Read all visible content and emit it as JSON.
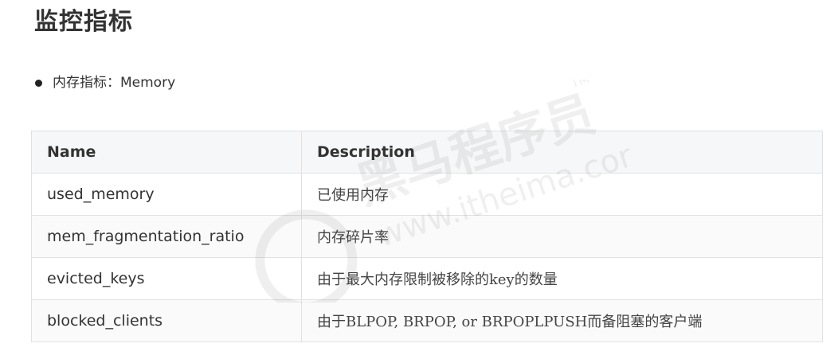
{
  "page": {
    "title": "监控指标"
  },
  "bullet": {
    "text": "内存指标：Memory"
  },
  "table": {
    "headers": [
      "Name",
      "Description"
    ],
    "rows": [
      {
        "name": "used_memory",
        "description": "已使用内存"
      },
      {
        "name": "mem_fragmentation_ratio",
        "description": "内存碎片率"
      },
      {
        "name": "evicted_keys",
        "description": "由于最大内存限制被移除的key的数量"
      },
      {
        "name": "blocked_clients",
        "description": "由于BLPOP, BRPOP, or BRPOPLPUSH而备阻塞的客户端"
      }
    ]
  },
  "watermark": {
    "brand": "黑马程序员",
    "url": "www.itheima.com",
    "mark": "TM"
  },
  "colors": {
    "text": "#333333",
    "header_bg": "#f6f7f8",
    "border": "#dfe2e5"
  }
}
